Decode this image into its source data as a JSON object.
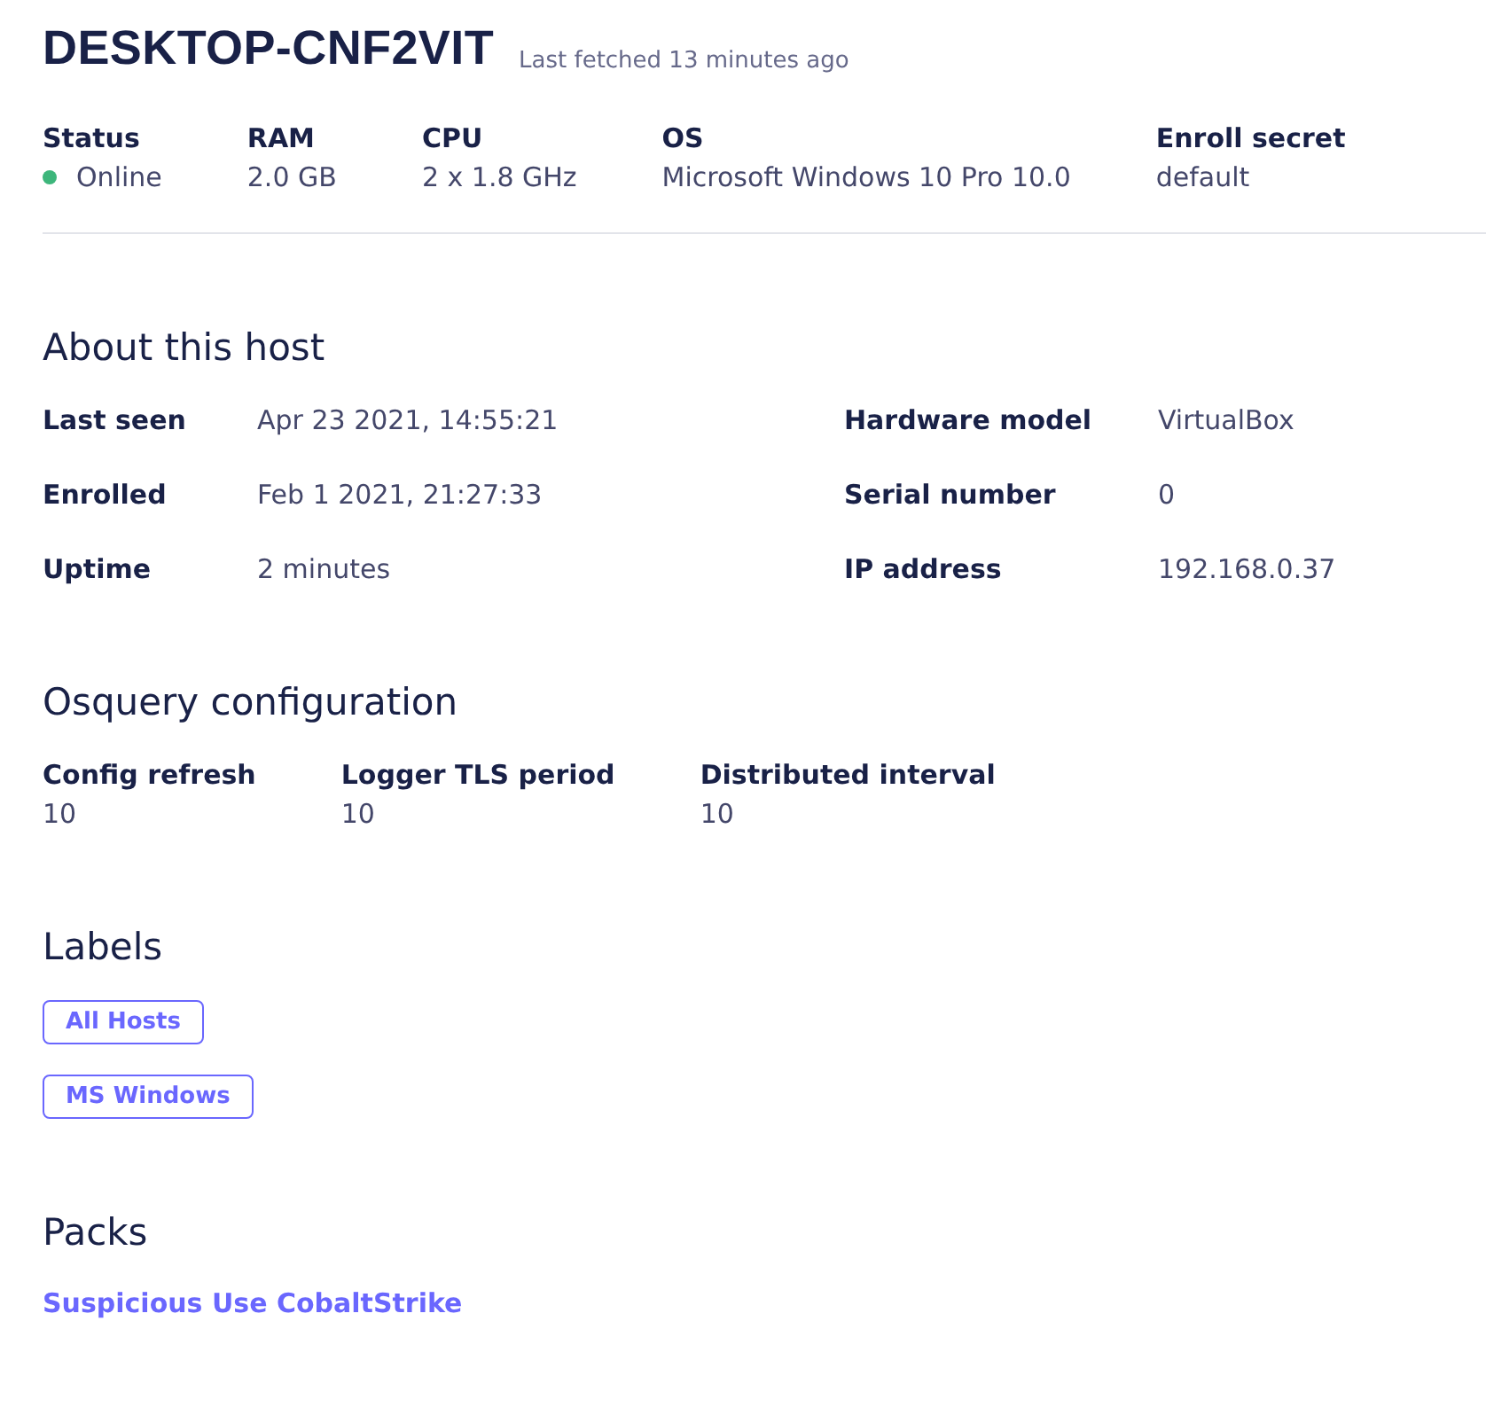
{
  "host": {
    "name": "DESKTOP-CNF2VIT",
    "last_fetched": "Last fetched 13 minutes ago"
  },
  "summary": [
    {
      "kind": "status",
      "label": "Status",
      "value": "Online",
      "color": "#3db67b"
    },
    {
      "kind": "text",
      "label": "RAM",
      "value": "2.0 GB"
    },
    {
      "kind": "text",
      "label": "CPU",
      "value": "2 x 1.8 GHz"
    },
    {
      "kind": "text",
      "label": "OS",
      "value": "Microsoft Windows 10 Pro 10.0"
    },
    {
      "kind": "text",
      "label": "Enroll secret",
      "value": "default"
    }
  ],
  "about": {
    "title": "About this host",
    "left": [
      {
        "label": "Last seen",
        "value": "Apr 23 2021, 14:55:21"
      },
      {
        "label": "Enrolled",
        "value": "Feb 1 2021, 21:27:33"
      },
      {
        "label": "Uptime",
        "value": "2 minutes"
      }
    ],
    "right": [
      {
        "label": "Hardware model",
        "value": "VirtualBox"
      },
      {
        "label": "Serial number",
        "value": "0"
      },
      {
        "label": "IP address",
        "value": "192.168.0.37"
      }
    ]
  },
  "osquery": {
    "title": "Osquery configuration",
    "items": [
      {
        "label": "Config refresh",
        "value": "10"
      },
      {
        "label": "Logger TLS period",
        "value": "10"
      },
      {
        "label": "Distributed interval",
        "value": "10"
      }
    ]
  },
  "labels": {
    "title": "Labels",
    "items": [
      "All Hosts",
      "MS Windows"
    ]
  },
  "packs": {
    "title": "Packs",
    "items": [
      "Suspicious Use CobaltStrike"
    ]
  }
}
